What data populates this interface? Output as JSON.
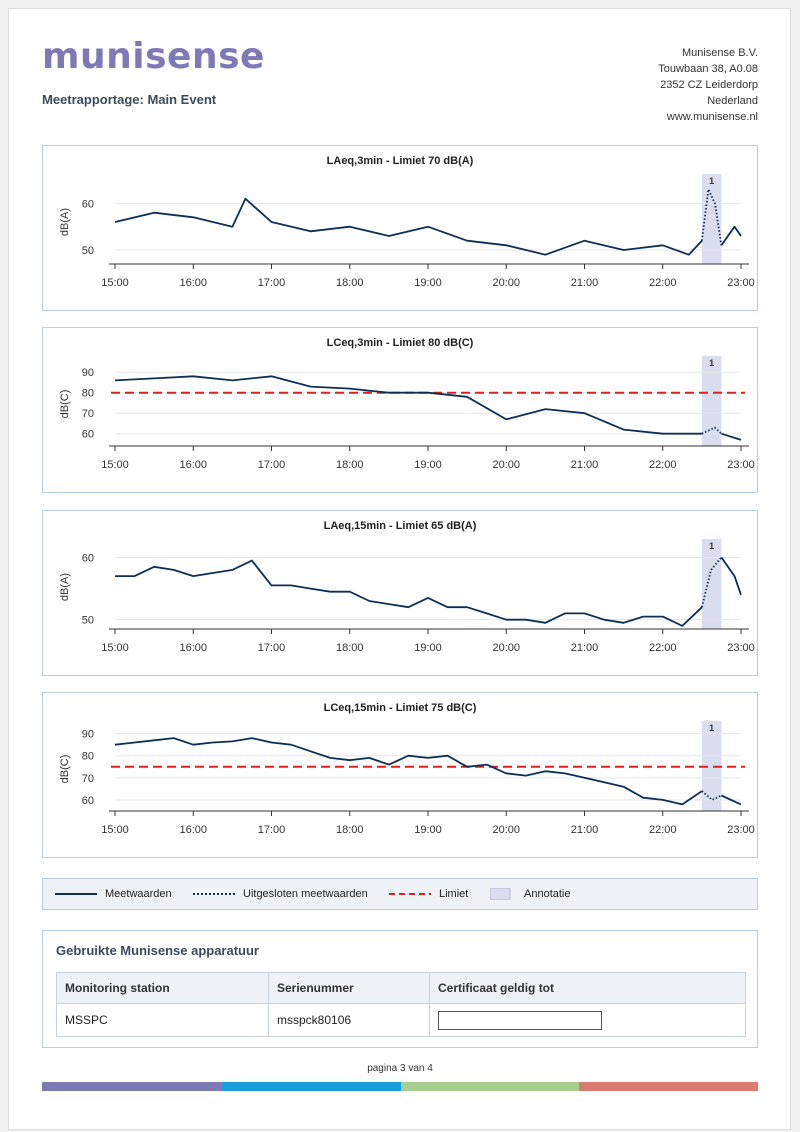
{
  "header": {
    "logo_text": "munisense",
    "report_title": "Meetrapportage: Main Event",
    "address_lines": [
      "Munisense B.V.",
      "Touwbaan 38, A0.08",
      "2352 CZ Leiderdorp",
      "Nederland",
      "www.munisense.nl"
    ]
  },
  "colors": {
    "line": "#0d2f57",
    "limit": "#e01e1e",
    "annotation": "#dadcf0",
    "brand": "#7e7ab8",
    "footer_bar": [
      "#7e7ab8",
      "#1a9ed9",
      "#a8cf8f",
      "#da7b72"
    ]
  },
  "chart_data": [
    {
      "type": "line",
      "title": "LAeq,3min - Limiet 70 dB(A)",
      "ylabel": "dB(A)",
      "yticks": [
        "50",
        "60"
      ],
      "xticks": [
        "15:00",
        "16:00",
        "17:00",
        "18:00",
        "19:00",
        "20:00",
        "21:00",
        "22:00",
        "23:00"
      ],
      "ylim": [
        47,
        65
      ],
      "limit": 70,
      "limit_visible": false,
      "annotation": {
        "label": "1",
        "start": "22:30",
        "end": "22:45"
      },
      "series": [
        {
          "style": "solid",
          "x": [
            "15:00",
            "15:30",
            "16:00",
            "16:30",
            "16:40",
            "17:00",
            "17:30",
            "18:00",
            "18:30",
            "19:00",
            "19:30",
            "20:00",
            "20:30",
            "21:00",
            "21:30",
            "22:00",
            "22:20",
            "22:30"
          ],
          "values": [
            56,
            58,
            57,
            55,
            61,
            56,
            54,
            55,
            53,
            55,
            52,
            51,
            49,
            52,
            50,
            51,
            49,
            52
          ]
        },
        {
          "style": "dotted",
          "x": [
            "22:30",
            "22:35",
            "22:40",
            "22:45"
          ],
          "values": [
            52,
            63,
            60,
            51
          ]
        },
        {
          "style": "solid",
          "x": [
            "22:45",
            "22:55",
            "23:00"
          ],
          "values": [
            51,
            55,
            53
          ]
        }
      ]
    },
    {
      "type": "line",
      "title": "LCeq,3min - Limiet 80 dB(C)",
      "ylabel": "dB(C)",
      "yticks": [
        "60",
        "70",
        "80",
        "90"
      ],
      "xticks": [
        "15:00",
        "16:00",
        "17:00",
        "18:00",
        "19:00",
        "20:00",
        "21:00",
        "22:00",
        "23:00"
      ],
      "ylim": [
        54,
        95
      ],
      "limit": 80,
      "limit_visible": true,
      "annotation": {
        "label": "1",
        "start": "22:30",
        "end": "22:45"
      },
      "series": [
        {
          "style": "solid",
          "x": [
            "15:00",
            "15:30",
            "16:00",
            "16:30",
            "17:00",
            "17:30",
            "18:00",
            "18:30",
            "19:00",
            "19:30",
            "20:00",
            "20:30",
            "21:00",
            "21:30",
            "22:00",
            "22:30"
          ],
          "values": [
            86,
            87,
            88,
            86,
            88,
            83,
            82,
            80,
            80,
            78,
            67,
            72,
            70,
            62,
            60,
            60
          ]
        },
        {
          "style": "dotted",
          "x": [
            "22:30",
            "22:40",
            "22:45"
          ],
          "values": [
            60,
            63,
            60
          ]
        },
        {
          "style": "solid",
          "x": [
            "22:45",
            "23:00"
          ],
          "values": [
            60,
            57
          ]
        }
      ]
    },
    {
      "type": "line",
      "title": "LAeq,15min - Limiet 65 dB(A)",
      "ylabel": "dB(A)",
      "yticks": [
        "50",
        "60"
      ],
      "xticks": [
        "15:00",
        "16:00",
        "17:00",
        "18:00",
        "19:00",
        "20:00",
        "21:00",
        "22:00",
        "23:00"
      ],
      "ylim": [
        48.5,
        62
      ],
      "limit": 65,
      "limit_visible": false,
      "annotation": {
        "label": "1",
        "start": "22:30",
        "end": "22:45"
      },
      "series": [
        {
          "style": "solid",
          "x": [
            "15:00",
            "15:15",
            "15:30",
            "15:45",
            "16:00",
            "16:15",
            "16:30",
            "16:45",
            "17:00",
            "17:15",
            "17:30",
            "17:45",
            "18:00",
            "18:15",
            "18:30",
            "18:45",
            "19:00",
            "19:15",
            "19:30",
            "19:45",
            "20:00",
            "20:15",
            "20:30",
            "20:45",
            "21:00",
            "21:15",
            "21:30",
            "21:45",
            "22:00",
            "22:15",
            "22:30"
          ],
          "values": [
            57,
            57,
            58.5,
            58,
            57,
            57.5,
            58,
            59.5,
            55.5,
            55.5,
            55,
            54.5,
            54.5,
            53,
            52.5,
            52,
            53.5,
            52,
            52,
            51,
            50,
            50,
            49.5,
            51,
            51,
            50,
            49.5,
            50.5,
            50.5,
            49,
            52
          ]
        },
        {
          "style": "dotted",
          "x": [
            "22:30",
            "22:37",
            "22:45"
          ],
          "values": [
            52,
            58,
            60
          ]
        },
        {
          "style": "solid",
          "x": [
            "22:45",
            "22:55",
            "23:00"
          ],
          "values": [
            60,
            57,
            54
          ]
        }
      ]
    },
    {
      "type": "line",
      "title": "LCeq,15min - Limiet 75 dB(C)",
      "ylabel": "dB(C)",
      "yticks": [
        "60",
        "70",
        "80",
        "90"
      ],
      "xticks": [
        "15:00",
        "16:00",
        "17:00",
        "18:00",
        "19:00",
        "20:00",
        "21:00",
        "22:00",
        "23:00"
      ],
      "ylim": [
        55,
        93
      ],
      "limit": 75,
      "limit_visible": true,
      "annotation": {
        "label": "1",
        "start": "22:30",
        "end": "22:45"
      },
      "series": [
        {
          "style": "solid",
          "x": [
            "15:00",
            "15:15",
            "15:30",
            "15:45",
            "16:00",
            "16:15",
            "16:30",
            "16:45",
            "17:00",
            "17:15",
            "17:30",
            "17:45",
            "18:00",
            "18:15",
            "18:30",
            "18:45",
            "19:00",
            "19:15",
            "19:30",
            "19:45",
            "20:00",
            "20:15",
            "20:30",
            "20:45",
            "21:00",
            "21:15",
            "21:30",
            "21:45",
            "22:00",
            "22:15",
            "22:30"
          ],
          "values": [
            85,
            86,
            87,
            88,
            85,
            86,
            86.5,
            88,
            86,
            85,
            82,
            79,
            78,
            79,
            76,
            80,
            79,
            80,
            75,
            76,
            72,
            71,
            73,
            72,
            70,
            68,
            66,
            61,
            60,
            58,
            64
          ]
        },
        {
          "style": "dotted",
          "x": [
            "22:30",
            "22:38",
            "22:45"
          ],
          "values": [
            64,
            60,
            62
          ]
        },
        {
          "style": "solid",
          "x": [
            "22:45",
            "23:00"
          ],
          "values": [
            62,
            58
          ]
        }
      ]
    }
  ],
  "legend": {
    "items": [
      {
        "label": "Meetwaarden"
      },
      {
        "label": "Uitgesloten meetwaarden"
      },
      {
        "label": "Limiet"
      },
      {
        "label": "Annotatie"
      }
    ]
  },
  "equipment": {
    "title": "Gebruikte Munisense apparatuur",
    "columns": [
      "Monitoring station",
      "Serienummer",
      "Certificaat geldig tot"
    ],
    "rows": [
      {
        "station": "MSSPC",
        "serial": "msspck80106",
        "certificate": ""
      }
    ]
  },
  "footer": {
    "page_text": "pagina 3 van 4"
  }
}
